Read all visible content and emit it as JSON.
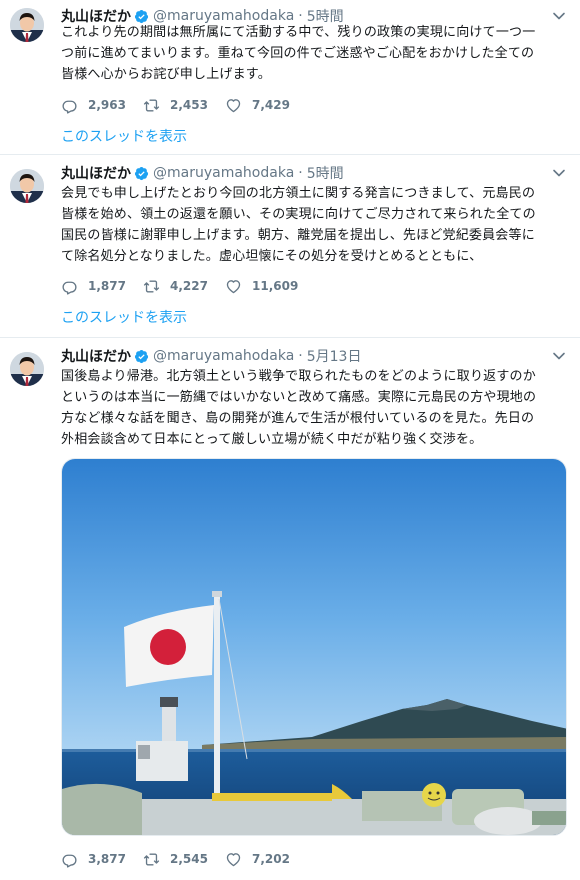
{
  "tweets": [
    {
      "name": "丸山ほだか",
      "handle": "@maruyamahodaka",
      "separator": "·",
      "time": "5時間",
      "lines": [
        "これより先の期間は無所属にて活動する中で、残りの政策の実現に向けて一つ一",
        "つ前に進めてまいります。重ねて今回の件でご迷惑やご心配をおかけした全ての",
        "皆様へ心からお詫び申し上げます。"
      ],
      "replies": "2,963",
      "retweets": "2,453",
      "likes": "7,429",
      "thread_link": "このスレッドを表示"
    },
    {
      "name": "丸山ほだか",
      "handle": "@maruyamahodaka",
      "separator": "·",
      "time": "5時間",
      "lines": [
        "会見でも申し上げたとおり今回の北方領土に関する発言につきまして、元島民の",
        "皆様を始め、領土の返還を願い、その実現に向けてご尽力されて来られた全ての",
        "国民の皆様に謝罪申し上げます。朝方、離党届を提出し、先ほど党紀委員会等に",
        "て除名処分となりました。虚心坦懐にその処分を受けとめるとともに、"
      ],
      "replies": "1,877",
      "retweets": "4,227",
      "likes": "11,609",
      "thread_link": "このスレッドを表示"
    },
    {
      "name": "丸山ほだか",
      "handle": "@maruyamahodaka",
      "separator": "·",
      "time": "5月13日",
      "lines": [
        "国後島より帰港。北方領土という戦争で取られたものをどのように取り返すのか",
        "というのは本当に一筋縄ではいかないと改めて痛感。実際に元島民の方や現地の",
        "方など様々な話を聞き、島の開発が進んで生活が根付いているのを見た。先日の",
        "外相会談含めて日本にとって厳しい立場が続く中だが粘り強く交渉を。"
      ],
      "replies": "3,877",
      "retweets": "2,545",
      "likes": "7,202"
    }
  ],
  "colors": {
    "accent": "#1da1f2",
    "muted": "#657786",
    "text": "#14171a",
    "divider": "#e6ecf0"
  },
  "icons": {
    "verified": "verified-badge-icon",
    "caret": "chevron-down-icon",
    "reply": "reply-icon",
    "retweet": "retweet-icon",
    "like": "heart-icon"
  }
}
